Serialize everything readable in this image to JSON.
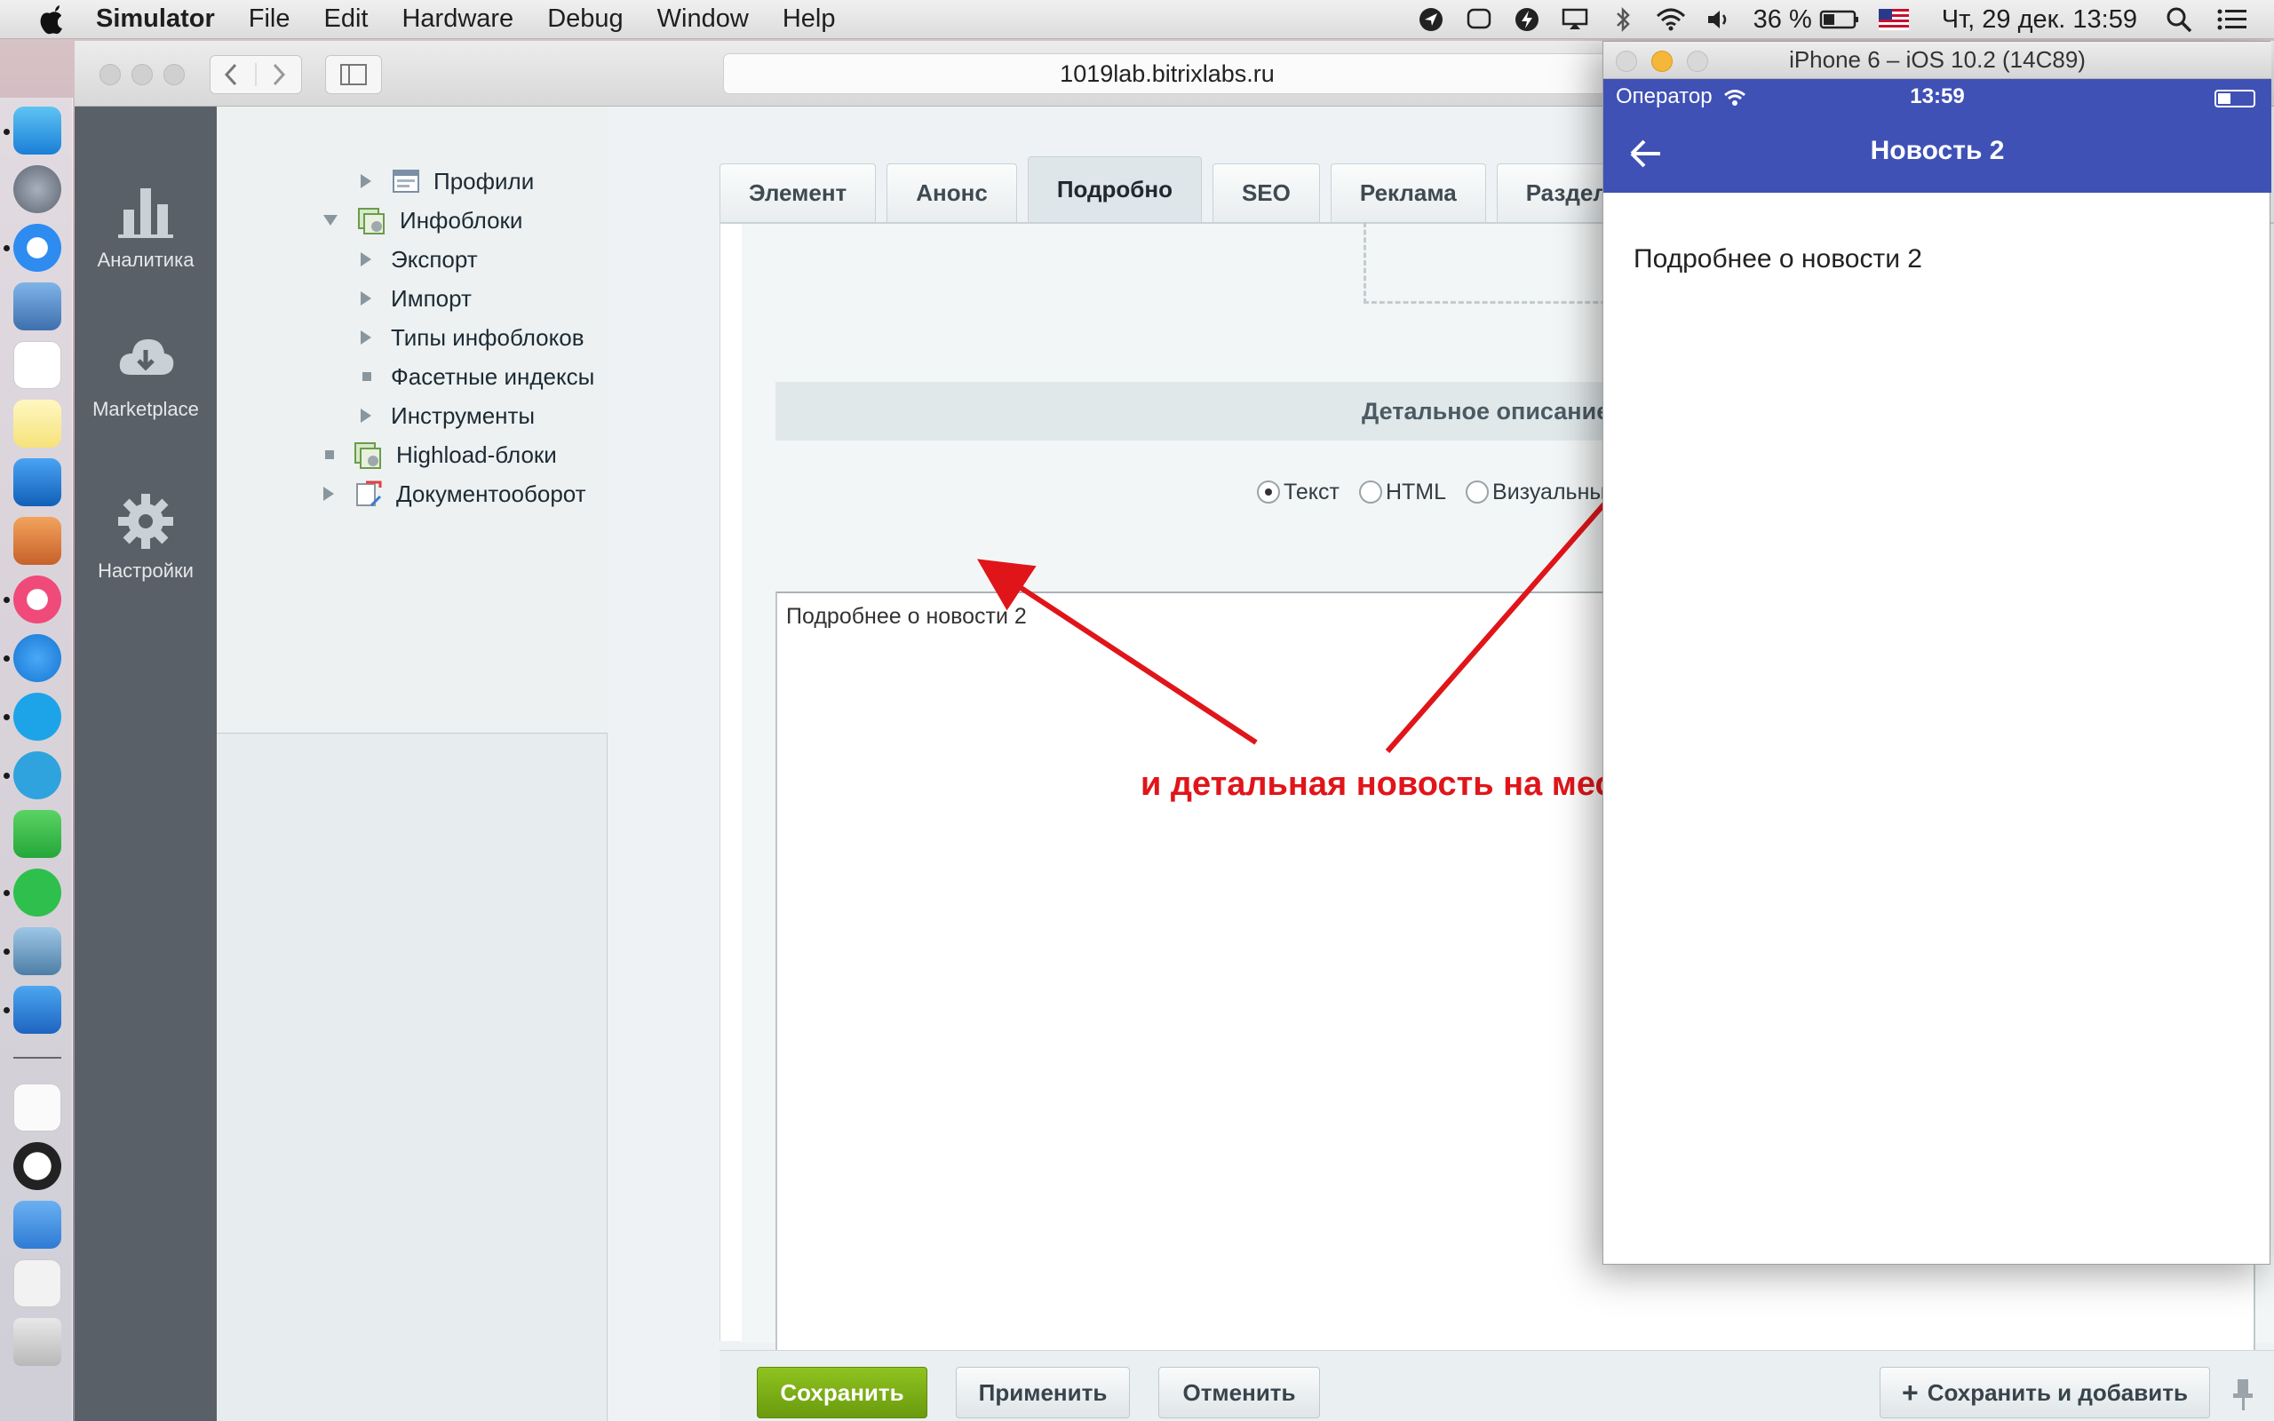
{
  "menubar": {
    "app": "Simulator",
    "items": [
      "File",
      "Edit",
      "Hardware",
      "Debug",
      "Window",
      "Help"
    ],
    "battery": "36 %",
    "datetime": "Чт, 29 дек.  13:59"
  },
  "browser": {
    "url": "1019lab.bitrixlabs.ru"
  },
  "panel": {
    "items": [
      {
        "label": "Аналитика",
        "icon": "bar-chart-icon"
      },
      {
        "label": "Marketplace",
        "icon": "cloud-download-icon"
      },
      {
        "label": "Настройки",
        "icon": "gear-icon"
      }
    ]
  },
  "tree": {
    "items": [
      {
        "label": "Профили"
      },
      {
        "label": "Инфоблоки"
      },
      {
        "label": "Экспорт"
      },
      {
        "label": "Импорт"
      },
      {
        "label": "Типы инфоблоков"
      },
      {
        "label": "Фасетные индексы"
      },
      {
        "label": "Инструменты"
      },
      {
        "label": "Highload-блоки"
      },
      {
        "label": "Документооборот"
      }
    ]
  },
  "tabs": [
    "Элемент",
    "Анонс",
    "Подробно",
    "SEO",
    "Реклама",
    "Разделы"
  ],
  "form": {
    "section_title": "Детальное описание",
    "radio_options": [
      "Текст",
      "HTML",
      "Визуальный ред"
    ],
    "selected_radio": "Текст",
    "detail_text": "Подробнее о новости 2"
  },
  "buttons": {
    "save": "Сохранить",
    "apply": "Применить",
    "cancel": "Отменить",
    "save_add": "Сохранить и добавить"
  },
  "simulator": {
    "window_title": "iPhone 6 – iOS 10.2 (14C89)",
    "carrier": "Оператор",
    "time": "13:59",
    "nav_title": "Новость 2",
    "body_text": "Подробнее о новости 2",
    "accent": "#3f51b5"
  },
  "annotation": {
    "text": "и детальная новость на месте",
    "color": "#e0151a"
  }
}
